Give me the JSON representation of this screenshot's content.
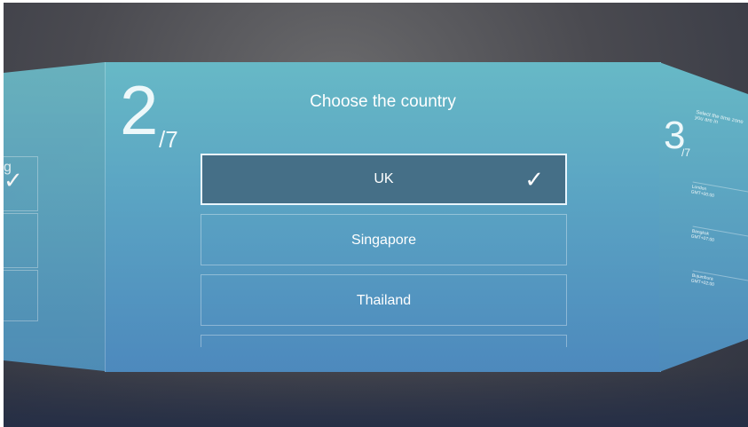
{
  "main": {
    "title": "Choose the country",
    "step_current": "2",
    "step_total": "/7",
    "options": [
      {
        "label": "UK",
        "selected": true
      },
      {
        "label": "Singapore",
        "selected": false
      },
      {
        "label": "Thailand",
        "selected": false
      }
    ]
  },
  "left_panel": {
    "title_fragment": "g"
  },
  "right_panel": {
    "step_current": "3",
    "step_total": "/7",
    "title": "Select the time zone you are in",
    "rows": [
      {
        "city": "London",
        "code": "GMT+00:00"
      },
      {
        "city": "Bangkok",
        "code": "GMT+07:00"
      },
      {
        "city": "Bujumbura",
        "code": "GMT+02:00"
      }
    ]
  },
  "icons": {
    "selected": "check-icon"
  }
}
